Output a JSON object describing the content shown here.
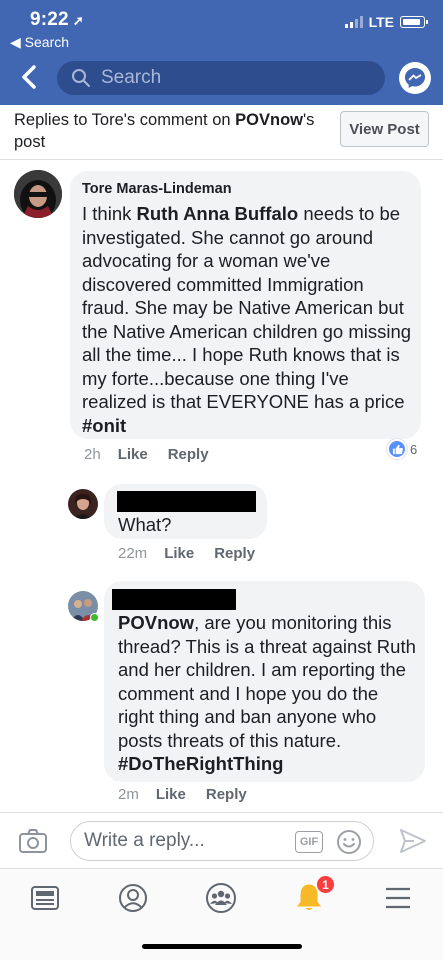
{
  "status": {
    "time": "9:22",
    "back_app": "Search",
    "network": "LTE"
  },
  "nav": {
    "search_placeholder": "Search"
  },
  "context": {
    "prefix": "Replies to ",
    "commenter": "Tore",
    "middle": "'s comment on ",
    "page": "POVnow",
    "suffix": "'s post",
    "view_post": "View Post"
  },
  "comments": [
    {
      "author": "Tore Maras-Lindeman",
      "text_parts": [
        "I think ",
        "Ruth Anna Buffalo",
        " needs to be investigated. She cannot go around advocating for a woman we've discovered committed Immigration fraud. She may be Native American but the Native American children go missing all the time... I hope Ruth knows that is my forte...because one thing I've realized is that EVERYONE has a price  ",
        "#onit"
      ],
      "time": "2h",
      "like": "Like",
      "reply": "Reply",
      "reactions": "6"
    },
    {
      "author": "",
      "text": "What?",
      "time": "22m",
      "like": "Like",
      "reply": "Reply"
    },
    {
      "author": "",
      "text_parts": [
        "POVnow",
        ", are you monitoring this thread? This is a threat against Ruth and her children. I am reporting the comment and I hope you do the right thing and ban anyone who posts threats of this nature. ",
        "#DoTheRightThing"
      ],
      "time": "2m",
      "like": "Like",
      "reply": "Reply"
    }
  ],
  "composer": {
    "placeholder": "Write a reply...",
    "gif_label": "GIF"
  },
  "tabbar": {
    "notifications_badge": "1"
  },
  "colors": {
    "brand": "#4267b2",
    "bubble": "#f2f3f5",
    "badge": "#fa3e3e"
  }
}
